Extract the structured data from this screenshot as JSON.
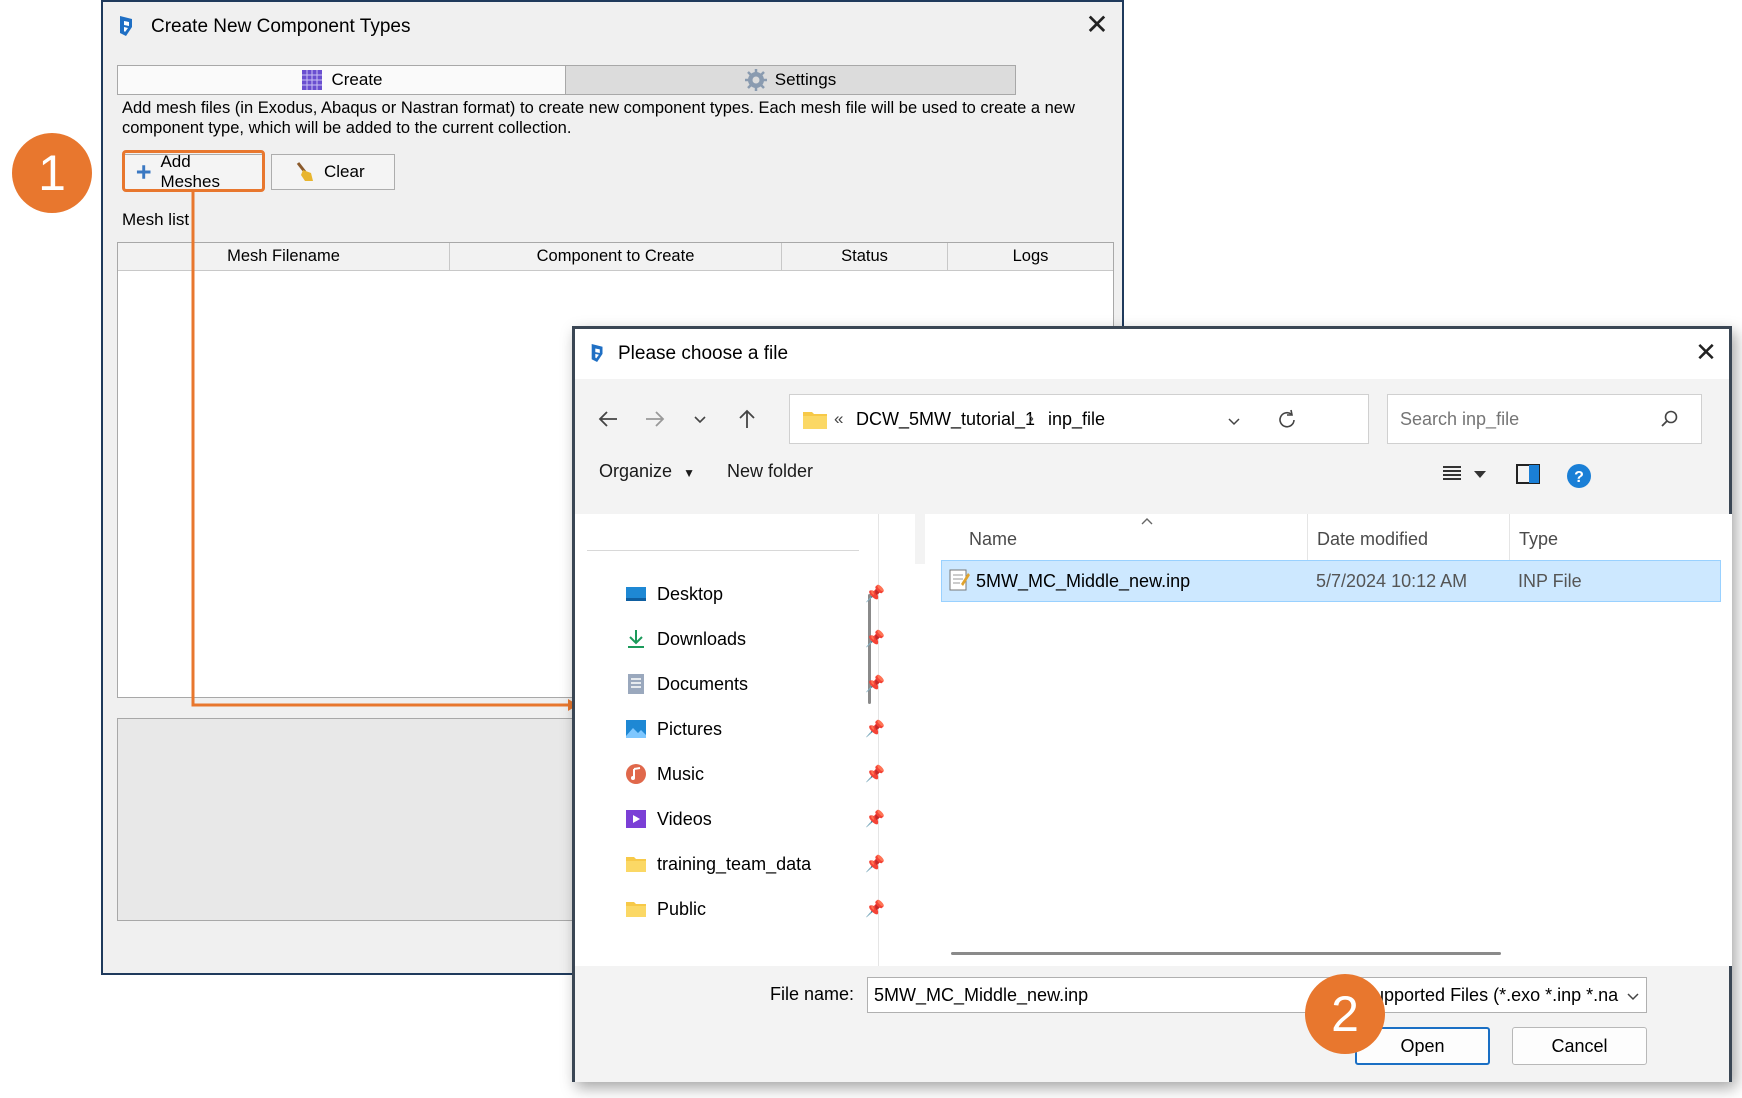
{
  "colors": {
    "callout": "#e8772e",
    "selected_row": "#cde8ff",
    "help": "#1a7fd6"
  },
  "win1": {
    "title": "Create New Component Types",
    "close": "✕",
    "tabs": [
      {
        "label": "Create",
        "active": true
      },
      {
        "label": "Settings",
        "active": false
      }
    ],
    "description": "Add mesh files (in Exodus, Abaqus or Nastran format) to create new component types. Each mesh file will be used to create a new component type, which will be added to the current collection.",
    "add_meshes_label": "Add Meshes",
    "clear_label": "Clear",
    "mesh_list_label": "Mesh list",
    "columns": [
      "Mesh Filename",
      "Component to Create",
      "Status",
      "Logs"
    ]
  },
  "callouts": [
    "1",
    "2"
  ],
  "win2": {
    "title": "Please choose a file",
    "close": "✕",
    "address": {
      "prefix": "«",
      "crumbs": [
        "DCW_5MW_tutorial_1",
        "inp_file"
      ],
      "sep": "›"
    },
    "search_placeholder": "Search inp_file",
    "organize_label": "Organize",
    "new_folder_label": "New folder",
    "nav_items": [
      {
        "label": "Desktop",
        "icon": "desktop-icon"
      },
      {
        "label": "Downloads",
        "icon": "download-icon"
      },
      {
        "label": "Documents",
        "icon": "document-icon"
      },
      {
        "label": "Pictures",
        "icon": "pictures-icon"
      },
      {
        "label": "Music",
        "icon": "music-icon"
      },
      {
        "label": "Videos",
        "icon": "videos-icon"
      },
      {
        "label": "training_team_data",
        "icon": "folder-icon"
      },
      {
        "label": "Public",
        "icon": "folder-icon"
      }
    ],
    "file_columns": [
      "Name",
      "Date modified",
      "Type"
    ],
    "files": [
      {
        "name": "5MW_MC_Middle_new.inp",
        "date": "5/7/2024 10:12 AM",
        "type": "INP File",
        "selected": true
      }
    ],
    "file_name_label": "File name:",
    "file_name_value": "5MW_MC_Middle_new.inp",
    "filter_value": "Supported Files (*.exo *.inp *.na",
    "open_label": "Open",
    "cancel_label": "Cancel"
  }
}
